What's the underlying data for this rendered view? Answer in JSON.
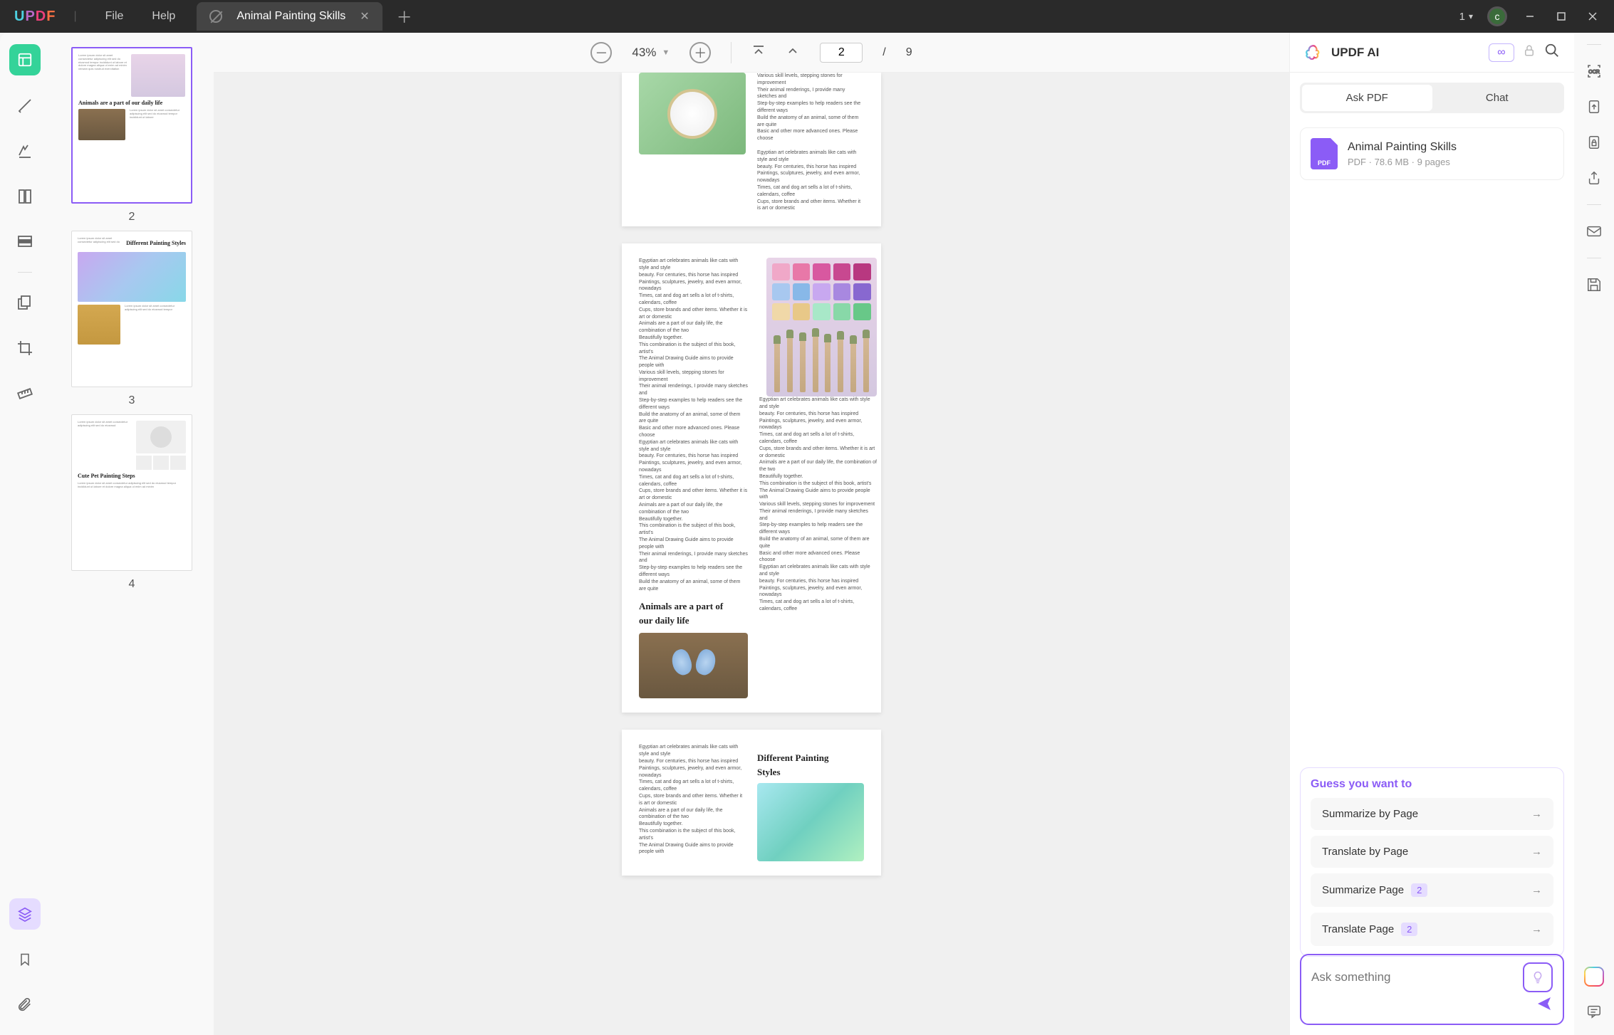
{
  "titlebar": {
    "logo_chars": [
      "U",
      "P",
      "D",
      "F"
    ],
    "menu": {
      "file": "File",
      "help": "Help"
    },
    "tab_title": "Animal Painting Skills",
    "doc_count": "1",
    "avatar_letter": "c"
  },
  "toolbar": {
    "zoom_pct": "43%",
    "current_page": "2",
    "total_pages": "9",
    "separator": "/"
  },
  "thumbnails": {
    "items": [
      {
        "num": "2",
        "heading": "Animals are a part of our daily life"
      },
      {
        "num": "3",
        "heading": "Different Painting Styles"
      },
      {
        "num": "4",
        "heading": "Cute Pet Painting Steps"
      }
    ]
  },
  "document": {
    "page2": {
      "left_text_a": "Various skill levels, stepping stones for improvement\nTheir animal renderings, I provide many sketches and\nStep-by-step examples to help readers see the different ways\nBuild the anatomy of an animal, some of them are quite\nBasic and other more advanced ones. Please choose",
      "left_text_b": "Egyptian art celebrates animals like cats with style and style\nbeauty. For centuries, this horse has inspired\nPaintings, sculptures, jewelry, and even armor, nowadays\nTimes, cat and dog art sells a lot of t-shirts, calendars, coffee\nCups, store brands and other items. Whether it is art or domestic"
    },
    "page3": {
      "heading": "Animals are a part of\nour daily life",
      "col_left": "Egyptian art celebrates animals like cats with style and style\nbeauty. For centuries, this horse has inspired\nPaintings, sculptures, jewelry, and even armor, nowadays\nTimes, cat and dog art sells a lot of t-shirts, calendars, coffee\nCups, store brands and other items. Whether it is art or domestic\nAnimals are a part of our daily life, the combination of the two\nBeautifully together.\nThis combination is the subject of this book, artist's\nThe Animal Drawing Guide aims to provide people with\nVarious skill levels, stepping stones for improvement\nTheir animal renderings, I provide many sketches and\nStep-by-step examples to help readers see the different ways\nBuild the anatomy of an animal, some of them are quite\nBasic and other more advanced ones. Please choose\nEgyptian art celebrates animals like cats with style and style\nbeauty. For centuries, this horse has inspired\nPaintings, sculptures, jewelry, and even armor, nowadays\nTimes, cat and dog art sells a lot of t-shirts, calendars, coffee\nCups, store brands and other items. Whether it is art or domestic\nAnimals are a part of our daily life, the combination of the two\nBeautifully together.\nThis combination is the subject of this book, artist's\nThe Animal Drawing Guide aims to provide people with\nTheir animal renderings, I provide many sketches and\nStep-by-step examples to help readers see the different ways\nBuild the anatomy of an animal, some of them are quite",
      "col_right": "Egyptian art celebrates animals like cats with style and style\nbeauty. For centuries, this horse has inspired\nPaintings, sculptures, jewelry, and even armor, nowadays\nTimes, cat and dog art sells a lot of t-shirts, calendars, coffee\nCups, store brands and other items. Whether it is art or domestic\nAnimals are a part of our daily life, the combination of the two\nBeautifully together.\nThis combination is the subject of this book, artist's\nThe Animal Drawing Guide aims to provide people with\nVarious skill levels, stepping stones for improvement\nTheir animal renderings, I provide many sketches and\nStep-by-step examples to help readers see the different ways\nBuild the anatomy of an animal, some of them are quite\nBasic and other more advanced ones. Please choose\nEgyptian art celebrates animals like cats with style and style\nbeauty. For centuries, this horse has inspired\nPaintings, sculptures, jewelry, and even armor, nowadays\nTimes, cat and dog art sells a lot of t-shirts, calendars, coffee"
    },
    "page4": {
      "heading": "Different Painting\nStyles",
      "col_left": "Egyptian art celebrates animals like cats with style and style\nbeauty. For centuries, this horse has inspired\nPaintings, sculptures, jewelry, and even armor, nowadays\nTimes, cat and dog art sells a lot of t-shirts, calendars, coffee\nCups, store brands and other items. Whether it is art or domestic\nAnimals are a part of our daily life, the combination of the two\nBeautifully together.\nThis combination is the subject of this book, artist's\nThe Animal Drawing Guide aims to provide people with"
    }
  },
  "ai": {
    "title": "UPDF AI",
    "tabs": {
      "ask_pdf": "Ask PDF",
      "chat": "Chat"
    },
    "file": {
      "name": "Animal Painting Skills",
      "meta_type": "PDF",
      "meta_size": "78.6 MB",
      "meta_pages": "9 pages",
      "dot": "·"
    },
    "suggest_title": "Guess you want to",
    "suggestions": [
      {
        "label": "Summarize by Page",
        "badge": ""
      },
      {
        "label": "Translate by Page",
        "badge": ""
      },
      {
        "label": "Summarize Page",
        "badge": "2"
      },
      {
        "label": "Translate Page",
        "badge": "2"
      }
    ],
    "ask_placeholder": "Ask something"
  }
}
